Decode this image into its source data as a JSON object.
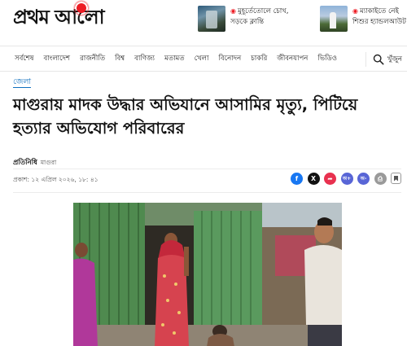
{
  "header": {
    "logo_text": "প্রথম আলো",
    "promos": [
      {
        "icon": "camera-icon",
        "text": "মুহূর্তেতোলে চোখ, সড়কে ক্লান্তি"
      },
      {
        "icon": "camera-icon",
        "text": "ম্যাকাইতে নেই শিশুর হ্যান্ডলআউট"
      }
    ]
  },
  "nav": {
    "items": [
      "সর্বশেষ",
      "বাংলাদেশ",
      "রাজনীতি",
      "বিশ্ব",
      "বাণিজ্য",
      "মতামত",
      "খেলা",
      "বিনোদন",
      "চাকরি",
      "জীবনযাপন",
      "ভিডিও"
    ],
    "search_label": "খুঁজুন"
  },
  "article": {
    "section": "জেলা",
    "headline": "মাগুরায় মাদক উদ্ধার অভিযানে আসামির মৃত্যু, পিটিয়ে হত্যার অভিযোগ পরিবারের",
    "author": "প্রতিনিধি",
    "location": "মাগুরা",
    "published": "প্রকাশ: ১২ এপ্রিল ২০২৬, ১৮: ৪১"
  },
  "share": {
    "buttons": [
      {
        "name": "facebook-share-button",
        "glyph": "f",
        "icon": "facebook-icon"
      },
      {
        "name": "x-share-button",
        "glyph": "X",
        "icon": "x-icon"
      },
      {
        "name": "share-button",
        "glyph": "➦",
        "icon": "share-icon"
      },
      {
        "name": "font-increase-button",
        "glyph": "অ+",
        "icon": "font-increase-icon"
      },
      {
        "name": "font-decrease-button",
        "glyph": "অ-",
        "icon": "font-decrease-icon"
      },
      {
        "name": "print-button",
        "glyph": "⎙",
        "icon": "print-icon"
      }
    ]
  },
  "colors": {
    "brand_red": "#ed1c24",
    "link_blue": "#0f6fbe",
    "facebook": "#1877f2"
  }
}
